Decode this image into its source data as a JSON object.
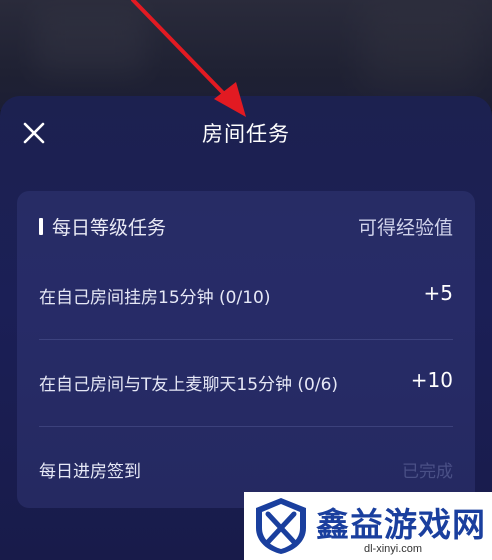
{
  "header": {
    "title": "房间任务"
  },
  "card": {
    "section_title": "每日等级任务",
    "reward_column_label": "可得经验值",
    "tasks": [
      {
        "label": "在自己房间挂房15分钟 (0/10)",
        "reward": "+5"
      },
      {
        "label": "在自己房间与T友上麦聊天15分钟 (0/6)",
        "reward": "+10"
      },
      {
        "label": "每日进房签到",
        "status": "已完成"
      }
    ]
  },
  "watermark": {
    "brand": "鑫益游戏网",
    "domain": "dl-xinyi.com"
  },
  "colors": {
    "sheet_bg": "#1c2150",
    "card_bg": "#2e356e",
    "annotation_arrow": "#e21a22",
    "watermark_blue": "#1a3f9e"
  }
}
